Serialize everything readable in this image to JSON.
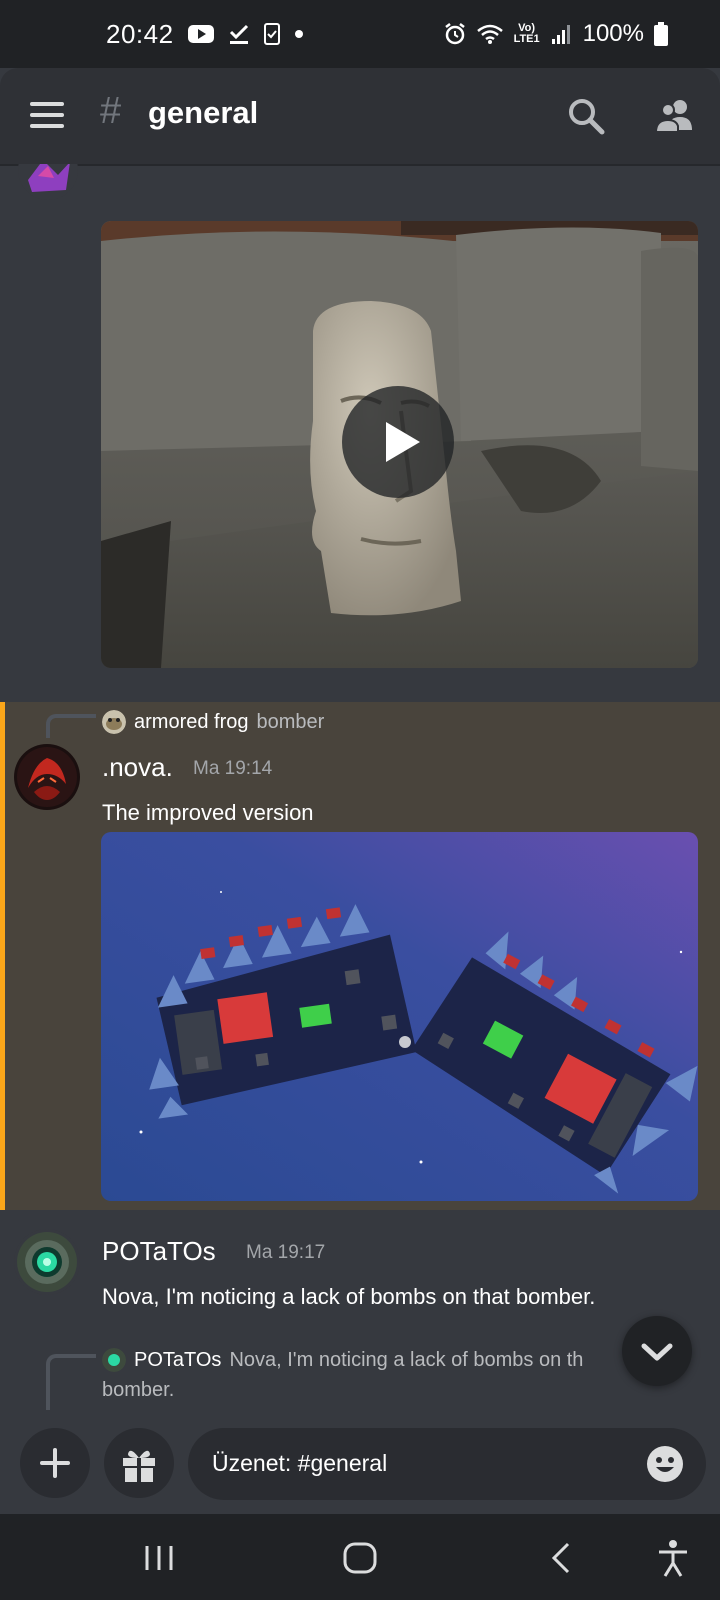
{
  "status_bar": {
    "time": "20:42",
    "network": "Vo) LTE1",
    "battery": "100%"
  },
  "header": {
    "channel_name": "general",
    "hash": "#"
  },
  "messages": {
    "highlighted": {
      "reply_to_user": "armored frog",
      "reply_to_text": "bomber",
      "author": ".nova.",
      "timestamp": "Ma 19:14",
      "text": "The improved version"
    },
    "potatos": {
      "author": "POTaTOs",
      "timestamp": "Ma 19:17",
      "text": "Nova, I'm noticing a lack of bombs on that bomber."
    },
    "reply_preview": {
      "user": "POTaTOs",
      "text": "Nova, I'm noticing a lack of bombs on th",
      "continuation": "bomber."
    }
  },
  "input": {
    "placeholder": "Üzenet: #general"
  },
  "colors": {
    "background": "#36393f",
    "highlight": "#49443c",
    "highlight_bar": "#faa61a"
  },
  "icons": [
    "hamburger-icon",
    "search-icon",
    "members-icon",
    "play-icon",
    "plus-icon",
    "gift-icon",
    "emoji-icon",
    "chevron-down-icon",
    "recents-icon",
    "home-icon",
    "back-icon",
    "accessibility-icon"
  ]
}
